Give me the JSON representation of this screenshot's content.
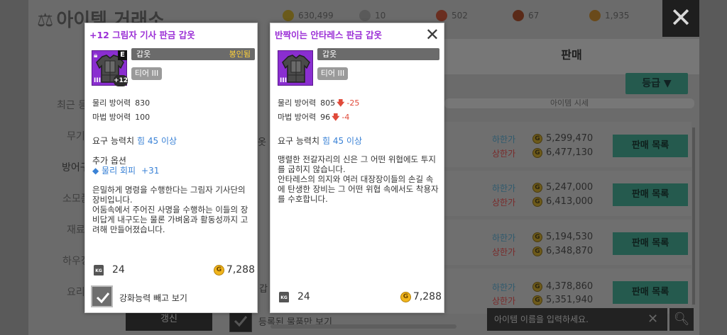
{
  "window": {
    "title": "아이템 거래소",
    "close_label": "✕"
  },
  "currencies": [
    {
      "icon": "gold-coin-icon",
      "value": "630,499"
    },
    {
      "icon": "crystal-icon",
      "value": "10"
    },
    {
      "icon": "leaf-icon",
      "value": "502"
    },
    {
      "icon": "shield-token-icon",
      "value": "67"
    },
    {
      "icon": "medal-icon",
      "value": "1,935"
    }
  ],
  "tabs": {
    "sell": "판매"
  },
  "filter": {
    "grade_label": "등급 ▼"
  },
  "price_header": "아이템 시세",
  "categories": [
    {
      "label": "최근 등"
    },
    {
      "label": "무기"
    },
    {
      "label": "방어구"
    },
    {
      "label": "소모품"
    },
    {
      "label": "재료"
    },
    {
      "label": "하우징"
    },
    {
      "label": "요리"
    }
  ],
  "listings": [
    {
      "low_label": "하한가",
      "low": "5,299,470",
      "high_label": "상한가",
      "high": "6,477,130",
      "button": "판매 목록"
    },
    {
      "low_label": "하한가",
      "low": "5,247,000",
      "high_label": "상한가",
      "high": "6,413,000",
      "button": "판매 목록"
    },
    {
      "low_label": "하한가",
      "low": "5,194,530",
      "high_label": "상한가",
      "high": "6,348,870",
      "button": "판매 목록"
    },
    {
      "low_label": "하한가",
      "low": "4,378,860",
      "high_label": "상한가",
      "high": "5,351,940",
      "button": "판매 목록"
    }
  ],
  "footer": {
    "refresh": "갱신",
    "registered_only": "등록된 물품만 보기",
    "search_placeholder": "아이템 이름을 입력하세요.",
    "clear": "✕"
  },
  "partial_texts": {
    "row1_fragment": "옷",
    "bottom_fragment": "갑"
  },
  "card1": {
    "title": "+12  그림자 기사 판금 갑옷",
    "type": "갑옷",
    "bound": "봉인됨",
    "badge_e": "E",
    "tier_mark": "III",
    "enhance": "+12",
    "tier": "티어 III",
    "stats": [
      {
        "label": "물리 방어력",
        "value": "830"
      },
      {
        "label": "마법 방어력",
        "value": "100"
      }
    ],
    "requirement_label": "요구 능력치",
    "requirement_value": "힘 45 이상",
    "extra_title": "추가 옵션",
    "extra_option": "◆ 물리 회피",
    "extra_value": "+31",
    "description": "은밀하게 명령을 수행한다는 그림자 기사단의 장비입니다.\n어둠속에서 주어진 사명을 수행하는 이들의 장비답게 내구도는 물론 가벼움과 활동성까지 고려해 만들어졌습니다.",
    "weight": "24",
    "price": "7,288",
    "enhance_check_label": "강화능력 빼고 보기"
  },
  "card2": {
    "title": "반짝이는 안타레스 판금 갑옷",
    "close": "✕",
    "type": "갑옷",
    "tier_mark": "III",
    "tier": "티어 III",
    "stats": [
      {
        "label": "물리 방어력",
        "value": "805",
        "diff": "-25"
      },
      {
        "label": "마법 방어력",
        "value": "96",
        "diff": "-4"
      }
    ],
    "requirement_label": "요구 능력치",
    "requirement_value": "힘 45 이상",
    "description": "맹렬한 전갈자리의 신은 그 어떤 위협에도 투지를 굽히지 않습니다.\n안타레스의 의지와 여러 대장장이들의 손길 속에 탄생한 장비는 그 어떤 위협 속에서도 착용자를 수호합니다.",
    "weight": "24",
    "price": "7,288"
  },
  "colors": {
    "title_purple": "#9b2fd6",
    "accent_blue": "#3a82d6",
    "decrease_red": "#e04a3a",
    "bound_yellow": "#ffd23a",
    "list_button_teal": "#255a4e"
  }
}
